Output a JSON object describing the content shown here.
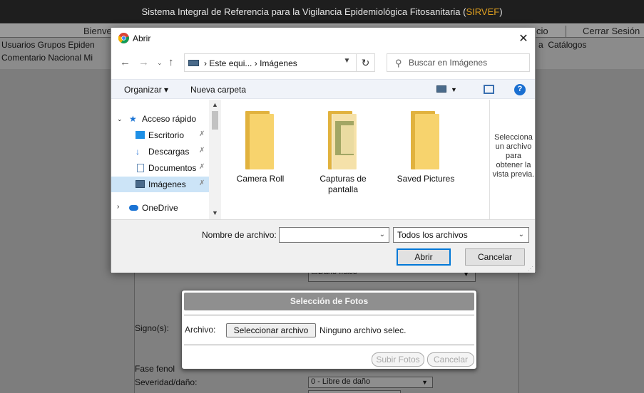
{
  "app": {
    "title_prefix": "Sistema Integral de Referencia para la Vigilancia Epidemiológica Fitosanitaria (",
    "title_brand": "SIRVEF",
    "title_suffix": ")",
    "nav_left": "Bienve",
    "nav_mid": "cio",
    "nav_right": "Cerrar Sesión",
    "menu_row1": "Usuarios  Grupos Epiden",
    "menu_row2": "Comentario Nacional  Mi",
    "menu_catalogs": "Catálogos"
  },
  "form": {
    "checkbox_label": "Daño físico",
    "signs_label": "Signo(s):",
    "phen_label": "Fase fenol",
    "severity_label": "Severidad/daño:",
    "severity_value": "0 - Libre de daño"
  },
  "photo_modal": {
    "title": "Selección de Fotos",
    "file_label": "Archivo:",
    "choose_button": "Seleccionar archivo",
    "no_file_text": "Ninguno archivo selec.",
    "upload_button": "Subir Fotos",
    "cancel_button": "Cancelar"
  },
  "dialog": {
    "title": "Abrir",
    "address": {
      "crumb_pc": "Este equi...",
      "crumb_sep": "›",
      "crumb_folder": "Imágenes"
    },
    "search_placeholder": "Buscar en Imágenes",
    "toolbar": {
      "organize": "Organizar ▾",
      "new_folder": "Nueva carpeta"
    },
    "nav_items": [
      {
        "label": "Acceso rápido",
        "icon": "star-icon"
      },
      {
        "label": "Escritorio",
        "icon": "desktop-icon"
      },
      {
        "label": "Descargas",
        "icon": "download-icon"
      },
      {
        "label": "Documentos",
        "icon": "documents-icon"
      },
      {
        "label": "Imágenes",
        "icon": "pictures-icon"
      },
      {
        "label": "OneDrive",
        "icon": "cloud-icon"
      }
    ],
    "files": [
      {
        "label": "Camera Roll",
        "icon": "folder-icon"
      },
      {
        "label": "Capturas de pantalla",
        "icon": "folder-icon"
      },
      {
        "label": "Saved Pictures",
        "icon": "folder-icon"
      }
    ],
    "preview_message": "Selecciona un archivo para obtener la vista previa.",
    "filename_label": "Nombre de archivo:",
    "filename_value": "",
    "file_type": "Todos los archivos",
    "open_button": "Abrir",
    "cancel_button": "Cancelar"
  },
  "colors": {
    "brand": "#e0a020",
    "selected": "#cce4f7",
    "folder": "#f7d36d",
    "accent": "#0078d7"
  }
}
